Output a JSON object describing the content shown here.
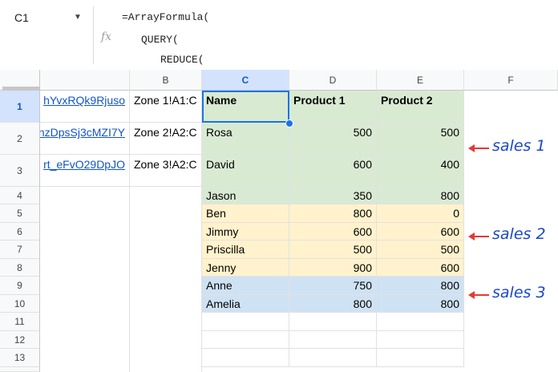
{
  "formula_bar": {
    "cell_ref": "C1",
    "fx_label": "fx",
    "lines": [
      "=ArrayFormula(",
      "QUERY(",
      "REDUCE("
    ]
  },
  "columns": [
    "B",
    "C",
    "D",
    "E",
    "F"
  ],
  "rows": [
    "1",
    "2",
    "3",
    "4",
    "5",
    "6",
    "7",
    "8",
    "9",
    "10",
    "11",
    "12",
    "13"
  ],
  "col_a": [
    "hYvxRQk9Rjuso",
    "nzDpsSj3cMZI7Y",
    "rt_eFvO29DpJO"
  ],
  "col_b": [
    "Zone 1!A1:C",
    "Zone 2!A2:C",
    "Zone 3!A2:C"
  ],
  "table": {
    "headers": [
      "Name",
      "Product 1",
      "Product 2"
    ],
    "rows": [
      [
        "Rosa",
        "500",
        "500"
      ],
      [
        "David",
        "600",
        "400"
      ],
      [
        "Jason",
        "350",
        "800"
      ],
      [
        "Ben",
        "800",
        "0"
      ],
      [
        "Jimmy",
        "600",
        "600"
      ],
      [
        "Priscilla",
        "500",
        "500"
      ],
      [
        "Jenny",
        "900",
        "600"
      ],
      [
        "Anne",
        "750",
        "800"
      ],
      [
        "Amelia",
        "800",
        "800"
      ]
    ]
  },
  "annotations": [
    "sales 1",
    "sales 2",
    "sales 3"
  ],
  "colors": {
    "green": "#d9ead3",
    "yellow": "#fff2cc",
    "blue": "#cfe2f3",
    "selection": "#1a73e8",
    "arrow": "#e53935"
  }
}
